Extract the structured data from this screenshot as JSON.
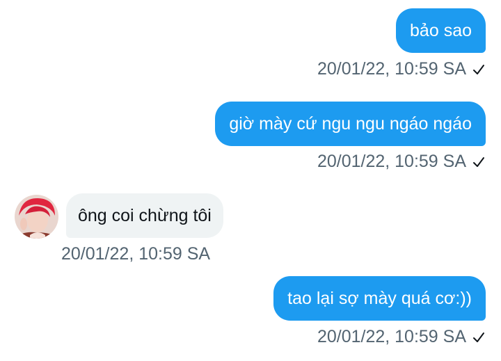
{
  "messages": [
    {
      "direction": "outgoing",
      "text": "bảo sao",
      "time": "20/01/22, 10:59 SA"
    },
    {
      "direction": "outgoing",
      "text": "giờ mày cứ ngu ngu ngáo ngáo",
      "time": "20/01/22, 10:59 SA"
    },
    {
      "direction": "incoming",
      "text": "ông coi chừng tôi",
      "time": "20/01/22, 10:59 SA"
    },
    {
      "direction": "outgoing",
      "text": "tao lại sợ mày quá cơ:))",
      "time": "20/01/22, 10:59 SA"
    }
  ],
  "icons": {
    "sent_status": "checkmark-icon",
    "sender_avatar": "avatar"
  },
  "colors": {
    "outgoing_bubble": "#1d9bf0",
    "incoming_bubble": "#eff3f4",
    "timestamp": "#536471"
  }
}
